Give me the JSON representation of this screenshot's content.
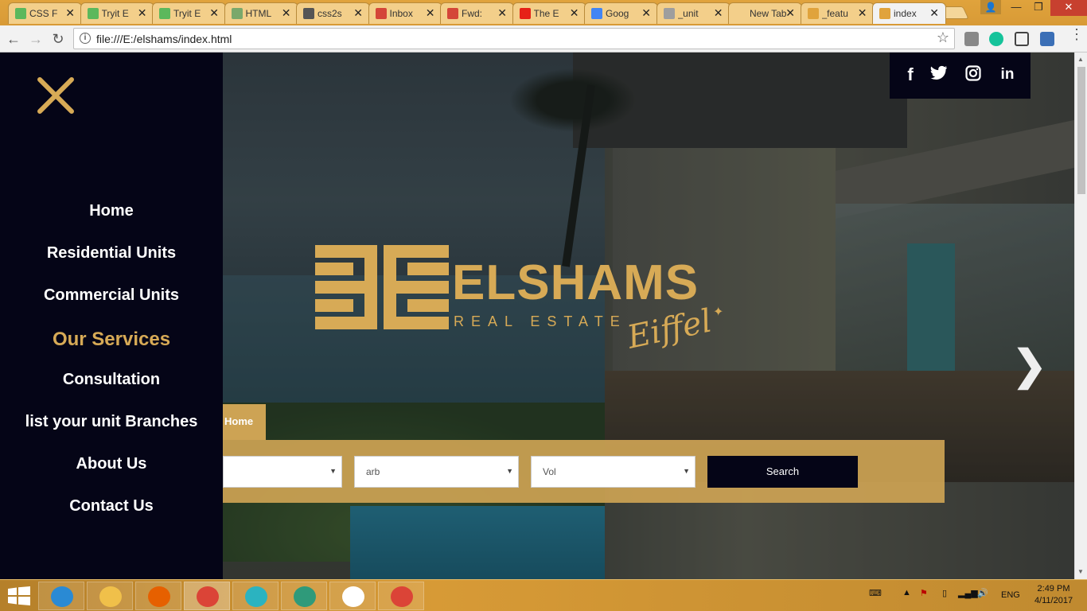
{
  "browser": {
    "tabs": [
      {
        "title": "CSS F",
        "favicon_color": "#5cb85c"
      },
      {
        "title": "Tryit E",
        "favicon_color": "#5cb85c"
      },
      {
        "title": "Tryit E",
        "favicon_color": "#5cb85c"
      },
      {
        "title": "HTML",
        "favicon_color": "#7aa86b"
      },
      {
        "title": "css2s",
        "favicon_color": "#555555"
      },
      {
        "title": "Inbox",
        "favicon_color": "#d44638"
      },
      {
        "title": "Fwd:",
        "favicon_color": "#d44638"
      },
      {
        "title": "The E",
        "favicon_color": "#e62117"
      },
      {
        "title": "Goog",
        "favicon_color": "#4285f4"
      },
      {
        "title": "_unit",
        "favicon_color": "#9e9e9e"
      },
      {
        "title": "New Tab",
        "favicon_color": ""
      },
      {
        "title": "_featu",
        "favicon_color": "#e0a33c"
      },
      {
        "title": "index",
        "favicon_color": "#e0a33c"
      }
    ],
    "address": "file:///E:/elshams/index.html"
  },
  "site": {
    "brand": "ELSHAMS",
    "tagline": "REAL ESTATE",
    "script": "Eiffel",
    "social": [
      "facebook",
      "twitter",
      "instagram",
      "linkedin"
    ],
    "nav": [
      {
        "label": "Home",
        "active": false
      },
      {
        "label": "Residential Units",
        "active": false
      },
      {
        "label": "Commercial Units",
        "active": false
      },
      {
        "label": "Our Services",
        "active": true
      },
      {
        "label": "Consultation",
        "active": false
      },
      {
        "label": "list your unit Branches",
        "active": false
      },
      {
        "label": "About Us",
        "active": false
      },
      {
        "label": "Contact Us",
        "active": false
      }
    ],
    "search": {
      "tab_label": "Home",
      "select_1": "",
      "select_2": "arb",
      "select_3": "Vol",
      "button": "Search"
    },
    "accent_color": "#d7aa56",
    "dark_color": "#050517"
  },
  "taskbar": {
    "apps": [
      "internet-explorer",
      "file-explorer",
      "firefox",
      "chrome",
      "app-store",
      "atom",
      "remote-desktop",
      "chrome"
    ],
    "language": "ENG",
    "time": "2:49 PM",
    "date": "4/11/2017"
  }
}
